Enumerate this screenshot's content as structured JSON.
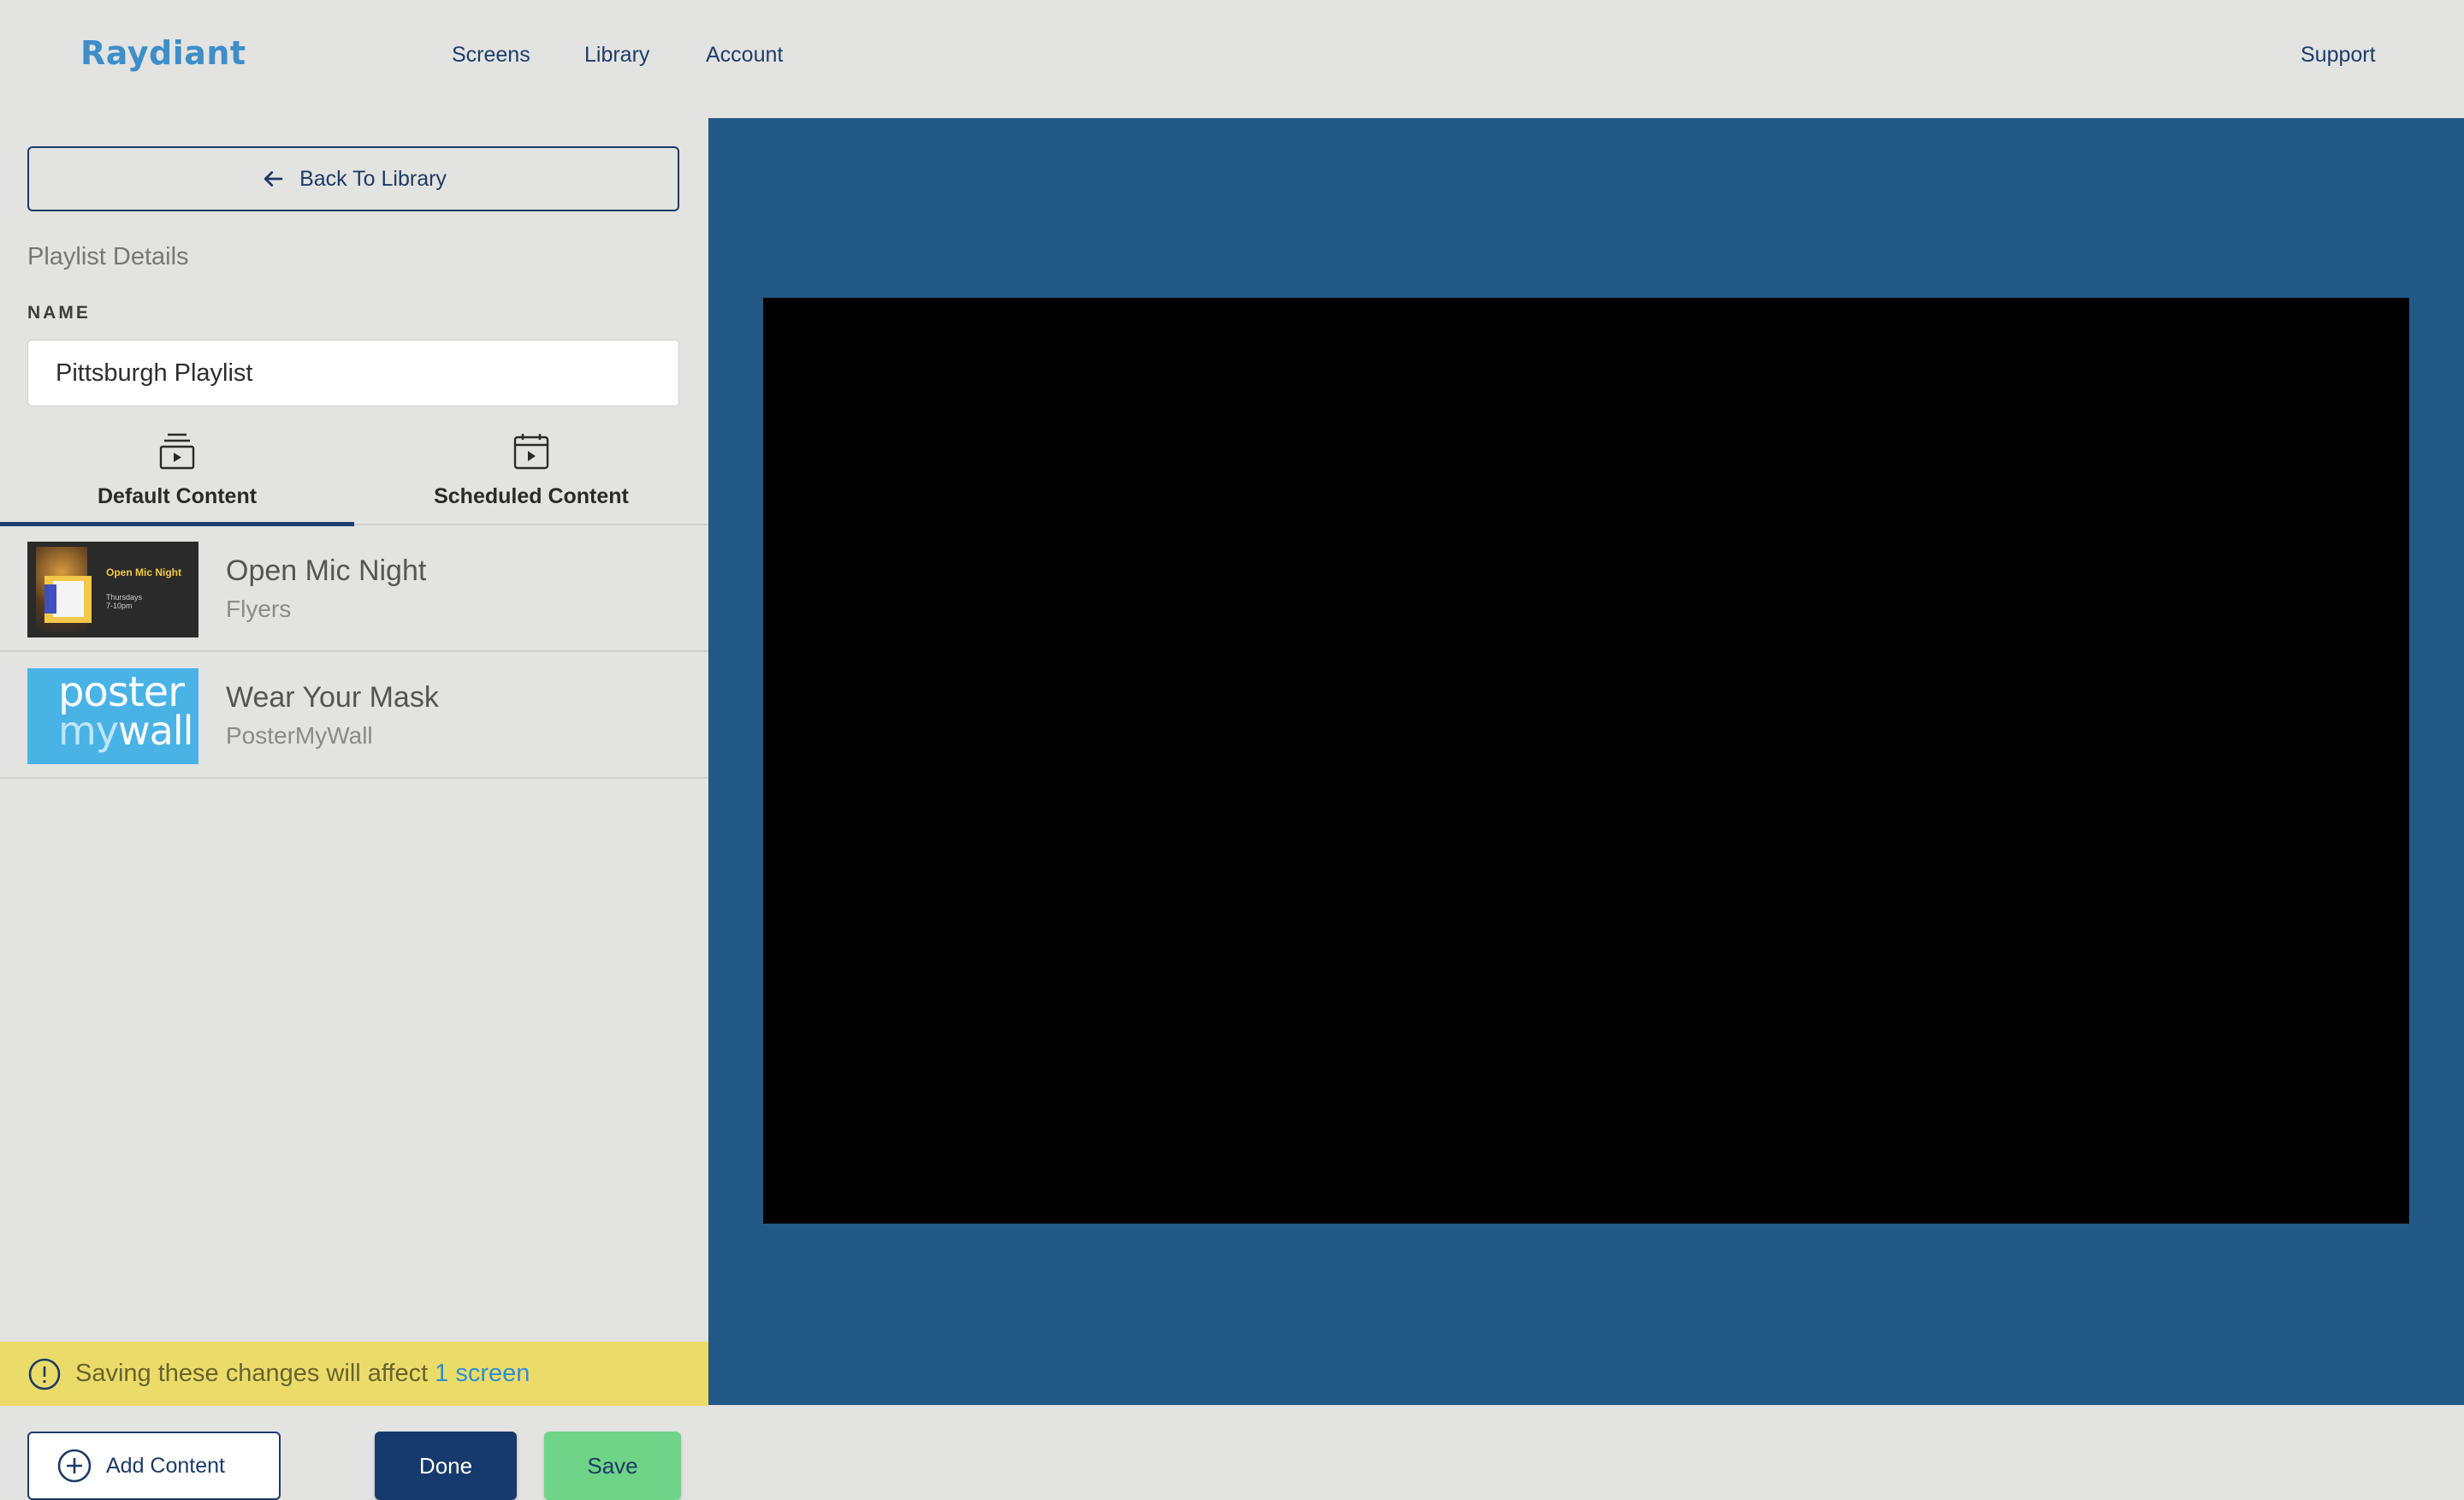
{
  "header": {
    "logo": "Raydiant",
    "nav": {
      "screens": "Screens",
      "library": "Library",
      "account": "Account"
    },
    "support": "Support"
  },
  "sidebar": {
    "back_label": "Back To Library",
    "section_title": "Playlist Details",
    "name_label": "NAME",
    "name_value": "Pittsburgh Playlist",
    "tabs": [
      {
        "label": "Default Content",
        "icon": "playlist-icon",
        "active": true
      },
      {
        "label": "Scheduled Content",
        "icon": "calendar-play-icon",
        "active": false
      }
    ],
    "items": [
      {
        "title": "Open Mic Night",
        "subtitle": "Flyers",
        "thumb_text": {
          "title": "Open Mic Night",
          "detail1": "Thursdays",
          "detail2": "7-10pm"
        }
      },
      {
        "title": "Wear Your Mask",
        "subtitle": "PosterMyWall",
        "thumb_text": {
          "line1": "poster",
          "my": "my",
          "wall": "wall"
        }
      }
    ],
    "warning": {
      "text": "Saving these changes will affect",
      "link": "1 screen"
    },
    "buttons": {
      "add": "Add Content",
      "done": "Done",
      "save": "Save"
    }
  },
  "colors": {
    "background": "#e3e3e1",
    "brand": "#3d8ec9",
    "navy": "#163a6b",
    "preview_bg": "#235987",
    "warning_bg": "#ebdc69",
    "save_green": "#6fd487"
  }
}
